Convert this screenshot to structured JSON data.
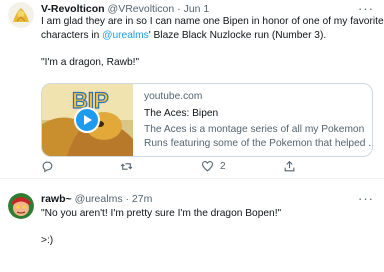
{
  "tweet1": {
    "display_name": "V-Revolticon",
    "handle": "@VRevolticon",
    "separator": "·",
    "date": "Jun 1",
    "line1": "I am glad they are in so I can name one Bipen in honor of  one of my favorite",
    "line2_pre": "characters in ",
    "line2_mention": "@urealms",
    "line2_post": "' Blaze Black Nuzlocke run (Number 3).",
    "line3": "\"I'm a dragon, Rawb!\"",
    "card": {
      "domain": "youtube.com",
      "title": "The Aces: Bipen",
      "desc1": "The Aces is a montage series of all my Pokemon",
      "desc2": "Runs featuring some of the Pokemon that helped ..."
    },
    "actions": {
      "reply_count": "",
      "retweet_count": "",
      "like_count": "2",
      "share_count": ""
    }
  },
  "tweet2": {
    "display_name": "rawb~",
    "handle": "@urealms",
    "separator": "·",
    "date": "27m",
    "line1": "\"No you aren't! I'm pretty sure I'm the dragon Bopen!\"",
    "line2": ">:)"
  },
  "colors": {
    "accent": "#1d9bf0",
    "secondary_text": "#536471",
    "border": "#cfd9de"
  },
  "icons": [
    "more-icon",
    "play-icon",
    "reply-icon",
    "retweet-icon",
    "like-icon",
    "share-icon"
  ]
}
